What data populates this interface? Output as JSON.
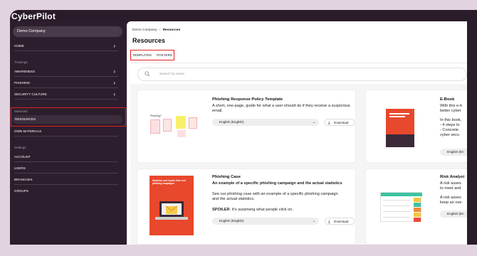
{
  "app": {
    "brand": "CyberPilot"
  },
  "sidebar": {
    "company": "Demo Company",
    "home": "HOME",
    "trainings_label": "Trainings",
    "trainings": [
      "AWARENESS",
      "PHISHING",
      "SECURITY CULTURE"
    ],
    "materials_label": "Materials",
    "resources": "RESOURCES",
    "own_materials": "OWN MATERIALS",
    "settings_label": "Settings",
    "settings": [
      "ACCOUNT",
      "USERS",
      "BRANCHES",
      "GROUPS"
    ]
  },
  "main": {
    "breadcrumb": {
      "parent": "Demo Company",
      "separator": "/",
      "current": "Resources"
    },
    "title": "Resources",
    "tabs": [
      "TEMPLATES",
      "POSTERS"
    ],
    "search_placeholder": "Search by name",
    "cards": [
      {
        "title": "Phishing Response Policy Template",
        "description": "A short, one-page, guide for what a user should do if they receive a suspicious email.",
        "language": "English (English)",
        "download": "Download",
        "thumb_caption": "Phishing?"
      },
      {
        "title": "E-Book",
        "lines": [
          "With this e-b",
          "better cyber",
          "In this book,",
          "- 4 steps to",
          "- Concrete",
          "cyber secu"
        ],
        "language": "English (En"
      },
      {
        "title": "Phishing Case",
        "subtitle": "An example of a specific phishing campaign and the actual statistics",
        "description": "See our phishing case with an example of a specific phishing campaign and the actual statistics.",
        "spoiler_label": "SPOILER",
        "spoiler_text": ": It's surprising what people click on.",
        "language": "English (English)",
        "download": "Download",
        "thumb_title": "Statistics and results from real phishing campaigns"
      },
      {
        "title": "Risk Analysi",
        "lines": [
          "A risk asses",
          "to meet and",
          "A risk asses",
          "keep an ove"
        ],
        "language": "English (En"
      }
    ]
  },
  "colors": {
    "sidebar_bg": "#2d1e2e",
    "highlight": "#e0201f",
    "outer_bg": "#e2d3e1",
    "thumb_red": "#e8482b"
  }
}
